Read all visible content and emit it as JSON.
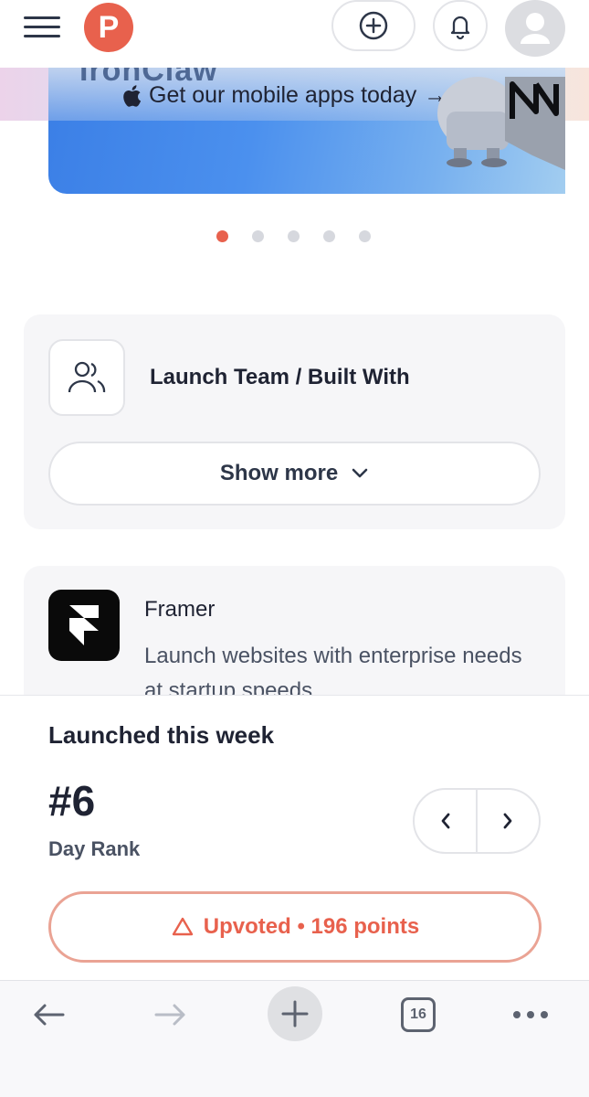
{
  "header": {
    "logo_letter": "P",
    "icons": [
      "menu-icon",
      "plus-circle-icon",
      "bell-icon",
      "user-avatar-icon"
    ],
    "accent_color": "#e8614d"
  },
  "banner": {
    "brand_word": "IronClaw",
    "cta": "Get our mobile apps today",
    "cta_arrow": "→",
    "icons": [
      "apple-icon",
      "near-logo-icon"
    ],
    "slides_total": 5,
    "active_slide": 1
  },
  "team_card": {
    "title": "Launch Team / Built With",
    "show_more": "Show more",
    "icons": [
      "users-icon",
      "chevron-down-icon"
    ]
  },
  "framer_card": {
    "name": "Framer",
    "description": "Launch websites with enterprise needs at startup speeds.",
    "icons": [
      "framer-logo-icon"
    ]
  },
  "launch_sheet": {
    "title": "Launched this week",
    "rank": "#6",
    "rank_label": "Day Rank",
    "upvote_label": "Upvoted • 196 points",
    "icons": [
      "chevron-left-icon",
      "chevron-right-icon",
      "upvote-triangle-icon"
    ]
  },
  "browser_toolbar": {
    "tab_count": "16",
    "icons": [
      "back-arrow-icon",
      "forward-arrow-icon",
      "new-tab-plus-icon",
      "tabs-icon",
      "more-dots-icon"
    ]
  }
}
